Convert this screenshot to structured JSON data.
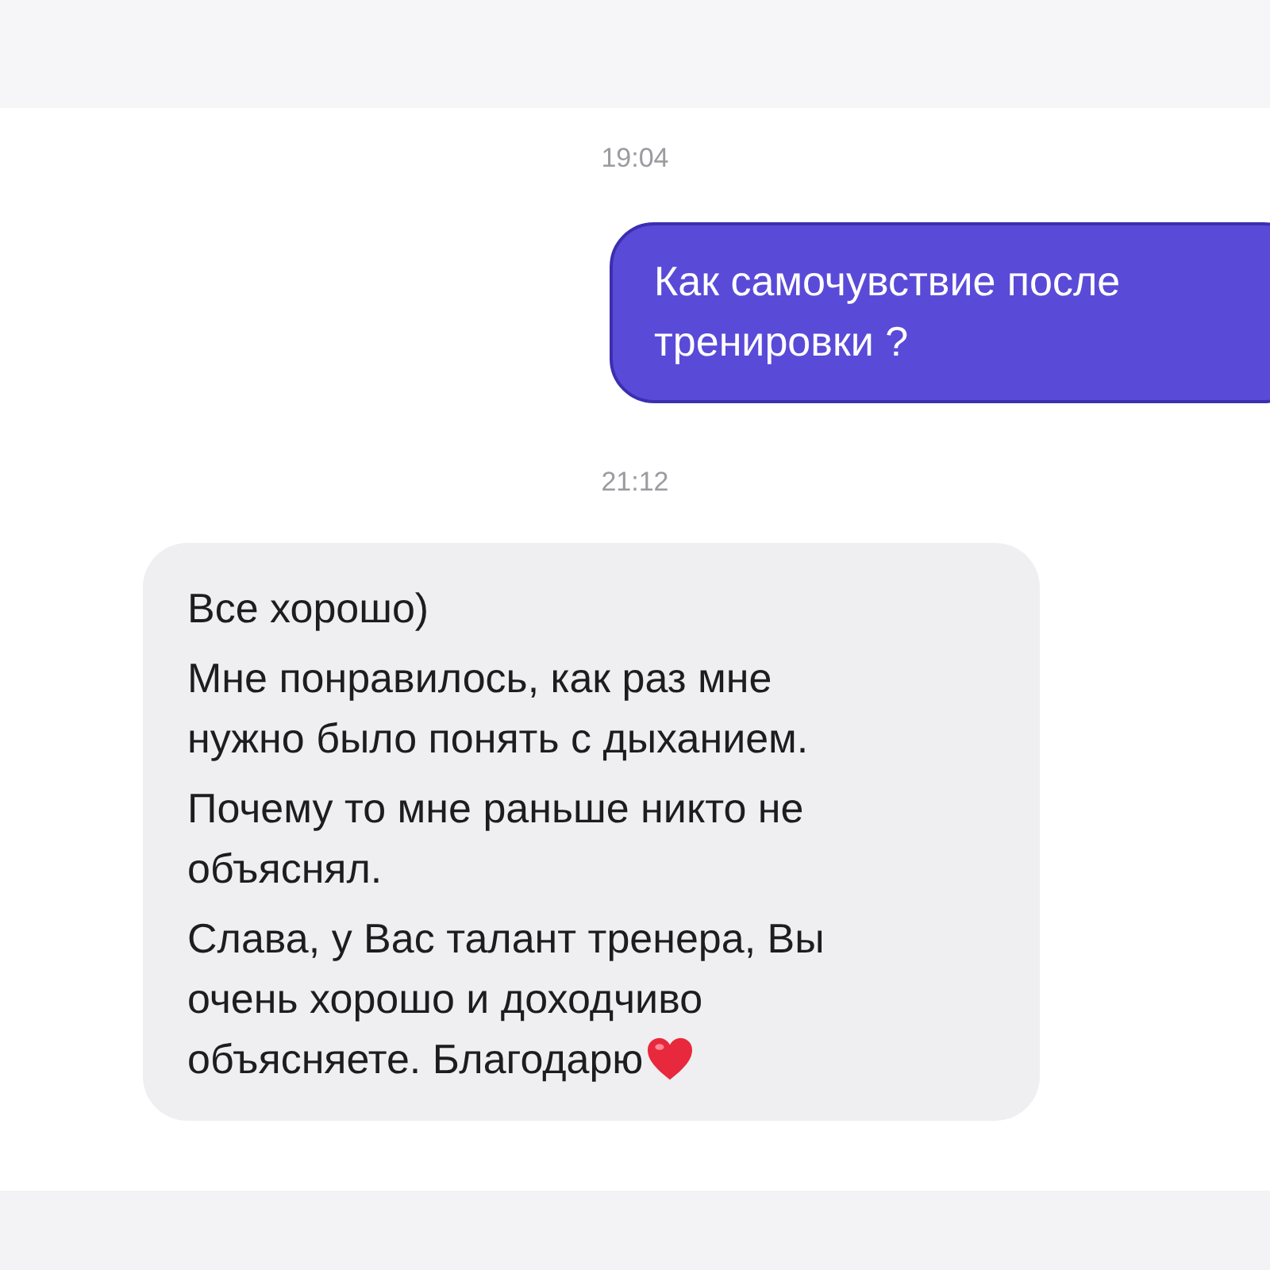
{
  "messages": [
    {
      "kind": "timestamp",
      "text": "19:04"
    },
    {
      "kind": "outgoing",
      "lines": [
        [
          "Как самочувствие после",
          "тренировки ?"
        ]
      ],
      "emoji": false
    },
    {
      "kind": "timestamp",
      "text": "21:12"
    },
    {
      "kind": "incoming",
      "lines": [
        [
          "Все хорошо)"
        ],
        [
          "Мне понравилось, как раз мне",
          "нужно было понять с дыханием."
        ],
        [
          "Почему то мне раньше никто не",
          "объяснял."
        ],
        [
          "Слава, у Вас талант тренера, Вы",
          "очень хорошо и доходчиво",
          "объясняете. Благодарю"
        ]
      ],
      "emoji": true
    }
  ]
}
